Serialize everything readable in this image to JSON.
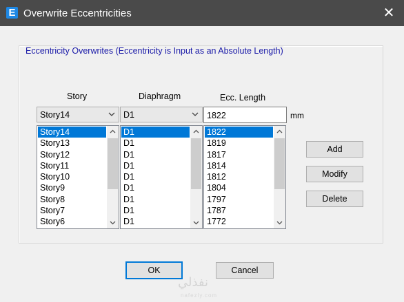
{
  "window": {
    "title": "Overwrite Eccentricities",
    "icon_letter": "E",
    "close_glyph": "✕"
  },
  "group": {
    "title": "Eccentricity Overwrites (Eccentricity is Input as an Absolute Length)"
  },
  "columns": {
    "story": "Story",
    "diaphragm": "Diaphragm",
    "ecc_length": "Ecc. Length"
  },
  "inputs": {
    "story_selected": "Story14",
    "diaphragm_selected": "D1",
    "ecc_value": "1822",
    "unit": "mm"
  },
  "lists": {
    "stories": [
      "Story14",
      "Story13",
      "Story12",
      "Story11",
      "Story10",
      "Story9",
      "Story8",
      "Story7",
      "Story6"
    ],
    "diaphragms": [
      "D1",
      "D1",
      "D1",
      "D1",
      "D1",
      "D1",
      "D1",
      "D1",
      "D1"
    ],
    "lengths": [
      "1822",
      "1819",
      "1817",
      "1814",
      "1812",
      "1804",
      "1797",
      "1787",
      "1772"
    ],
    "selected_index": 0
  },
  "buttons": {
    "add": "Add",
    "modify": "Modify",
    "delete": "Delete",
    "ok": "OK",
    "cancel": "Cancel"
  },
  "watermark": {
    "text": "نفذلي",
    "sub": "nafezly.com"
  },
  "colors": {
    "titlebar": "#4a4a4a",
    "selection": "#0078d7",
    "group_title": "#1a1aa8"
  }
}
